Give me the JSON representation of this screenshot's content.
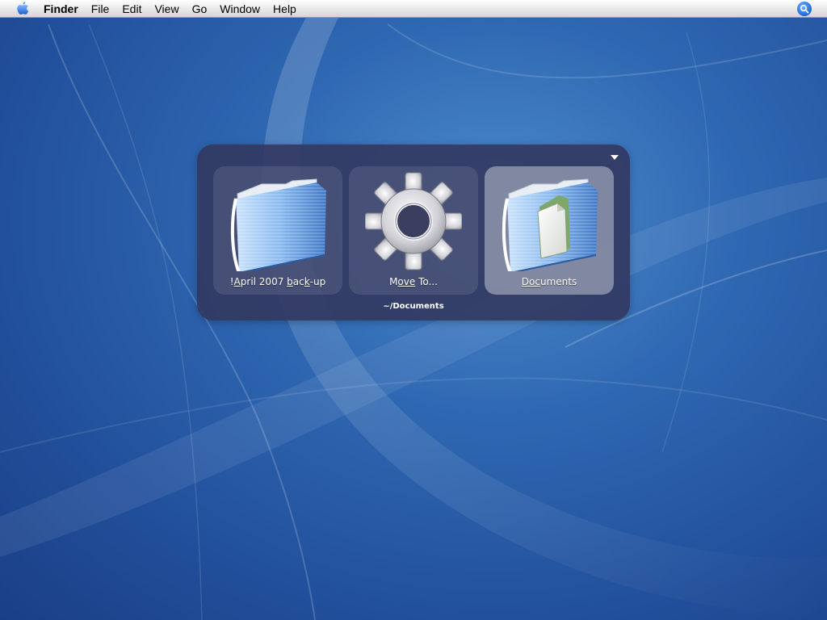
{
  "menubar": {
    "apple_icon": "apple-icon",
    "app_name": "Finder",
    "items": [
      "File",
      "Edit",
      "View",
      "Go",
      "Window",
      "Help"
    ],
    "spotlight_icon": "spotlight-search-icon"
  },
  "launcher": {
    "menu_icon": "triangle-down-icon",
    "panes": [
      {
        "icon": "folder-icon",
        "label_parts": [
          "!",
          "A",
          "pril 2007 ",
          "b",
          "ac",
          "k",
          "-up"
        ],
        "selected": false
      },
      {
        "icon": "gear-icon",
        "label_parts": [
          "M",
          "ove",
          " To..."
        ],
        "selected": false
      },
      {
        "icon": "documents-folder-icon",
        "label_parts": [
          "Doc",
          "uments"
        ],
        "selected": true
      }
    ],
    "path": "~/Documents"
  },
  "colors": {
    "desktop": "#2f68b2",
    "panel": "#32375f",
    "selection": "#7c7f9e"
  }
}
